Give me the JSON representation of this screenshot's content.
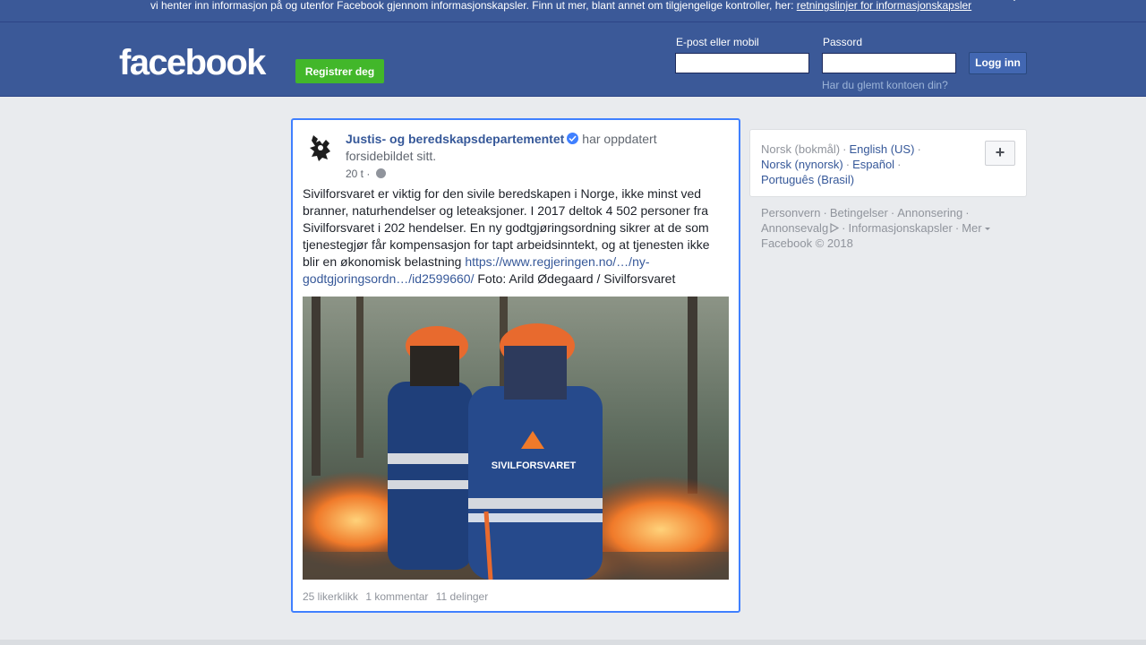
{
  "cookie_banner": {
    "text": "vi henter inn informasjon på og utenfor Facebook gjennom informasjonskapsler. Finn ut mer, blant annet om tilgjengelige kontroller, her: ",
    "link": "retningslinjer for informasjonskapsler"
  },
  "header": {
    "logo": "facebook",
    "register_label": "Registrer deg",
    "email_label": "E-post eller mobil",
    "email_value": "",
    "password_label": "Passord",
    "password_value": "",
    "login_label": "Logg inn",
    "forgot_label": "Har du glemt kontoen din?"
  },
  "post": {
    "page_name": "Justis- og beredskapsdepartementet",
    "action_text": "har oppdatert forsidebildet sitt.",
    "time": "20 t",
    "time_separator": "·",
    "body_text": "Sivilforsvaret er viktig for den sivile beredskapen i Norge, ikke minst ved branner, naturhendelser og leteaksjoner. I 2017 deltok 4 502 personer fra Sivilforsvaret i 202 hendelser. En ny godtgjøringsordning sikrer at de som tjenestegjør får kompensasjon for tapt arbeidsinntekt, og at tjenesten ikke blir en økonomisk belastning ",
    "body_link": "https://www.regjeringen.no/…/ny-godtgjoringsordn…/id2599660/",
    "photo_credit": " Foto: Arild Ødegaard / Sivilforsvaret",
    "image_text": "SIVILFORSVARET",
    "likes": "25 likerklikk",
    "comments": "1 kommentar",
    "shares": "11 delinger"
  },
  "languages": {
    "current": "Norsk (bokmål)",
    "options": [
      "English (US)",
      "Norsk (nynorsk)",
      "Español",
      "Português (Brasil)"
    ],
    "add_label": "+"
  },
  "footer": {
    "links": [
      "Personvern",
      "Betingelser",
      "Annonsering",
      "Annonsevalg",
      "Informasjonskapsler",
      "Mer"
    ],
    "copyright": "Facebook © 2018"
  },
  "colors": {
    "brand_blue": "#3b5998",
    "register_green": "#42b72a",
    "link_blue": "#365899",
    "focus_border": "#4080ff"
  }
}
